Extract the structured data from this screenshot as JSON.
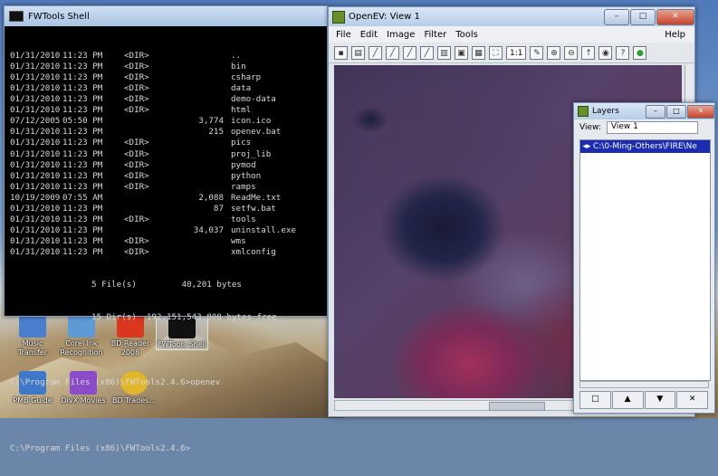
{
  "console": {
    "title": "FWTools Shell",
    "rows": [
      {
        "date": "01/31/2010",
        "time": "11:23 PM",
        "dir": "<DIR>",
        "size": "",
        "name": ".."
      },
      {
        "date": "01/31/2010",
        "time": "11:23 PM",
        "dir": "<DIR>",
        "size": "",
        "name": "bin"
      },
      {
        "date": "01/31/2010",
        "time": "11:23 PM",
        "dir": "<DIR>",
        "size": "",
        "name": "csharp"
      },
      {
        "date": "01/31/2010",
        "time": "11:23 PM",
        "dir": "<DIR>",
        "size": "",
        "name": "data"
      },
      {
        "date": "01/31/2010",
        "time": "11:23 PM",
        "dir": "<DIR>",
        "size": "",
        "name": "demo-data"
      },
      {
        "date": "01/31/2010",
        "time": "11:23 PM",
        "dir": "<DIR>",
        "size": "",
        "name": "html"
      },
      {
        "date": "07/12/2005",
        "time": "05:50 PM",
        "dir": "",
        "size": "3,774",
        "name": "icon.ico"
      },
      {
        "date": "01/31/2010",
        "time": "11:23 PM",
        "dir": "",
        "size": "215",
        "name": "openev.bat"
      },
      {
        "date": "01/31/2010",
        "time": "11:23 PM",
        "dir": "<DIR>",
        "size": "",
        "name": "pics"
      },
      {
        "date": "01/31/2010",
        "time": "11:23 PM",
        "dir": "<DIR>",
        "size": "",
        "name": "proj_lib"
      },
      {
        "date": "01/31/2010",
        "time": "11:23 PM",
        "dir": "<DIR>",
        "size": "",
        "name": "pymod"
      },
      {
        "date": "01/31/2010",
        "time": "11:23 PM",
        "dir": "<DIR>",
        "size": "",
        "name": "python"
      },
      {
        "date": "01/31/2010",
        "time": "11:23 PM",
        "dir": "<DIR>",
        "size": "",
        "name": "ramps"
      },
      {
        "date": "10/19/2009",
        "time": "07:55 AM",
        "dir": "",
        "size": "2,088",
        "name": "ReadMe.txt"
      },
      {
        "date": "01/31/2010",
        "time": "11:23 PM",
        "dir": "",
        "size": "87",
        "name": "setfw.bat"
      },
      {
        "date": "01/31/2010",
        "time": "11:23 PM",
        "dir": "<DIR>",
        "size": "",
        "name": "tools"
      },
      {
        "date": "01/31/2010",
        "time": "11:23 PM",
        "dir": "",
        "size": "34,037",
        "name": "uninstall.exe"
      },
      {
        "date": "01/31/2010",
        "time": "11:23 PM",
        "dir": "<DIR>",
        "size": "",
        "name": "wms"
      },
      {
        "date": "01/31/2010",
        "time": "11:23 PM",
        "dir": "<DIR>",
        "size": "",
        "name": "xmlconfig"
      }
    ],
    "summary_files": "5 File(s)         40,201 bytes",
    "summary_dirs": "15 Dir(s)  192,151,543,808 bytes free",
    "prompt1": "C:\\Program Files (x86)\\FWTools2.4.6>openev",
    "prompt2": "C:\\Program Files (x86)\\FWTools2.4.6>"
  },
  "desktop_icons": [
    {
      "label": "Music Transfer",
      "color": "#4a7fd0"
    },
    {
      "label": "Corel Ink Recognition",
      "color": "#5e9bd6"
    },
    {
      "label": "BD Reader 2008",
      "color": "#d9371e"
    },
    {
      "label": "FWTools Shell",
      "color": "#111111"
    },
    {
      "label": "PMB Guide",
      "color": "#3f78c9"
    },
    {
      "label": "DivX Movies",
      "color": "#8a4cc9"
    },
    {
      "label": "BD Trades...",
      "color": "#e2b62a"
    }
  ],
  "openev": {
    "title": "OpenEV: View 1",
    "menu": [
      "File",
      "Edit",
      "Image",
      "Filter",
      "Tools"
    ],
    "help": "Help",
    "zoom_label": "1:1"
  },
  "layers": {
    "title": "Layers",
    "view_label": "View:",
    "view_value": "View 1",
    "items": [
      "C:\\0-Ming-Others\\FIRE\\Ne"
    ],
    "footer": [
      "□",
      "▲",
      "▼",
      "✕"
    ]
  }
}
